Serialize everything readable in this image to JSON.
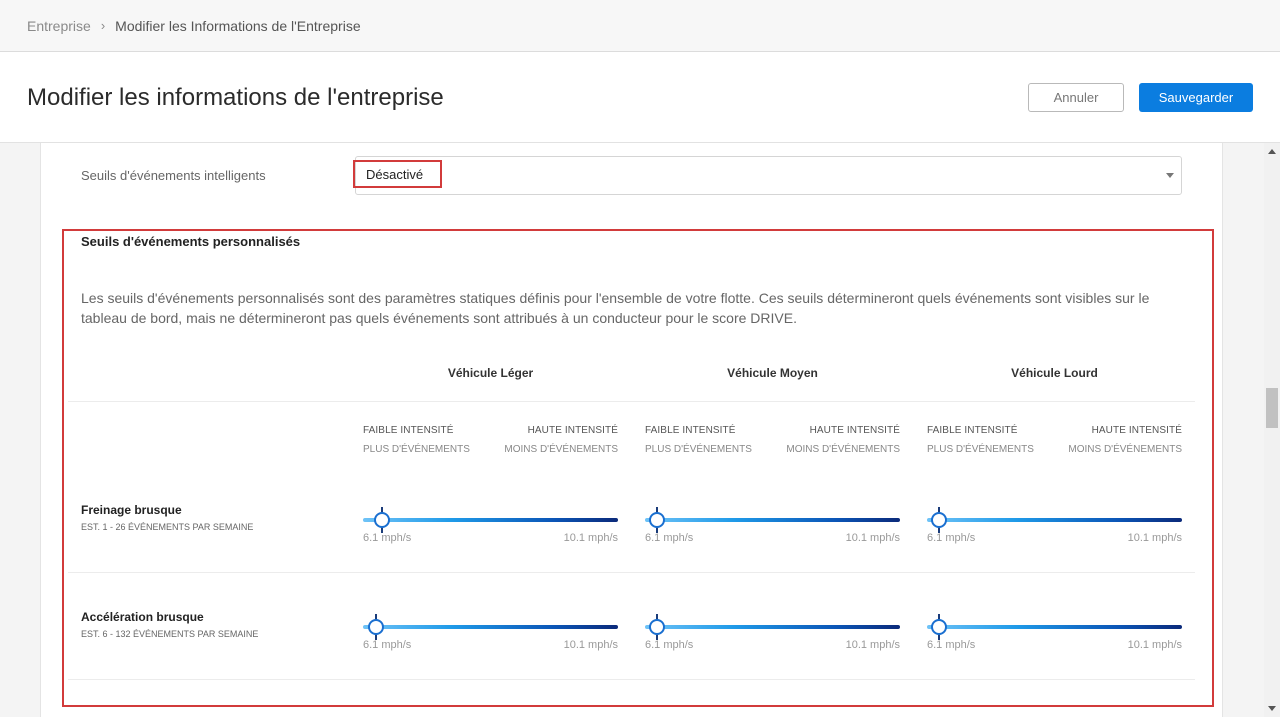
{
  "breadcrumb": {
    "parent": "Entreprise",
    "separator": "›",
    "current": "Modifier les Informations de l'Entreprise"
  },
  "header": {
    "title": "Modifier les informations de l'entreprise",
    "cancel_label": "Annuler",
    "save_label": "Sauvegarder"
  },
  "smart_thresholds": {
    "label": "Seuils d'événements intelligents",
    "value": "Désactivé"
  },
  "custom": {
    "title": "Seuils d'événements personnalisés",
    "description": "Les seuils d'événements personnalisés sont des paramètres statiques définis pour l'ensemble de votre flotte. Ces seuils détermineront quels événements sont visibles sur le tableau de bord, mais ne détermineront pas quels événements sont attribués à un conducteur pour le score DRIVE.",
    "columns": [
      "Véhicule Léger",
      "Véhicule Moyen",
      "Véhicule Lourd"
    ],
    "low_intensity": "FAIBLE INTENSITÉ",
    "high_intensity": "HAUTE INTENSITÉ",
    "more_events": "PLUS D'ÉVÉNEMENTS",
    "fewer_events": "MOINS D'ÉVÉNEMENTS",
    "rows": [
      {
        "title": "Freinage brusque",
        "subtitle": "EST. 1 - 26 ÉVÉNEMENTS PAR SEMAINE",
        "min": "6.1 mph/s",
        "max": "10.1 mph/s"
      },
      {
        "title": "Accélération brusque",
        "subtitle": "EST. 6 - 132 ÉVÉNEMENTS PAR SEMAINE",
        "min": "6.1 mph/s",
        "max": "10.1 mph/s"
      }
    ]
  },
  "colors": {
    "accent": "#0b7de0",
    "highlight": "#d23b3b"
  }
}
